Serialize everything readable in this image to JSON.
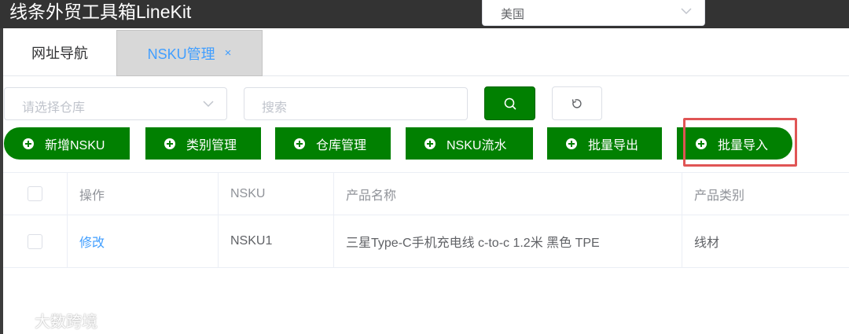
{
  "app": {
    "title": "线条外贸工具箱LineKit"
  },
  "country_select": {
    "value": "美国"
  },
  "tabs": [
    {
      "label": "网址导航"
    },
    {
      "label": "NSKU管理",
      "close": "×"
    }
  ],
  "filters": {
    "warehouse_placeholder": "请选择仓库",
    "search_placeholder": "搜索"
  },
  "actions": [
    {
      "label": "新增NSKU"
    },
    {
      "label": "类别管理"
    },
    {
      "label": "仓库管理"
    },
    {
      "label": "NSKU流水"
    },
    {
      "label": "批量导出"
    },
    {
      "label": "批量导入"
    }
  ],
  "table": {
    "columns": [
      "操作",
      "NSKU",
      "产品名称",
      "产品类别"
    ],
    "rows": [
      {
        "action": "修改",
        "nsku": "NSKU1",
        "name": "三星Type-C手机充电线 c-to-c 1.2米 黑色 TPE",
        "category": "线材"
      }
    ]
  },
  "watermark": {
    "text": "大数跨境"
  },
  "colors": {
    "primary_green": "#018001",
    "link_blue": "#409eff",
    "highlight_red": "#e05555",
    "topbar": "#333333"
  }
}
